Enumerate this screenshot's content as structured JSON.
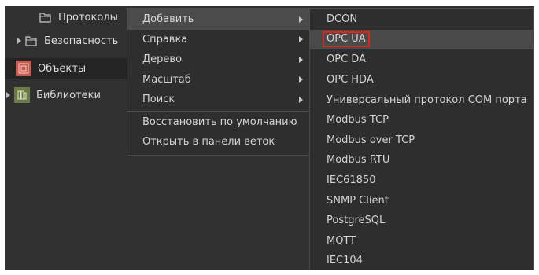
{
  "tree": {
    "items": [
      {
        "label": "Протоколы",
        "icon": "folder-icon"
      },
      {
        "label": "Безопасность",
        "icon": "folder-icon"
      },
      {
        "label": "Объекты",
        "icon": "objects-icon"
      },
      {
        "label": "Библиотеки",
        "icon": "libraries-icon"
      }
    ]
  },
  "context_menu": {
    "items": [
      {
        "label": "Добавить",
        "has_submenu": true
      },
      {
        "label": "Справка",
        "has_submenu": true
      },
      {
        "label": "Дерево",
        "has_submenu": true
      },
      {
        "label": "Масштаб",
        "has_submenu": true
      },
      {
        "label": "Поиск",
        "has_submenu": true
      },
      {
        "label": "Восстановить по умолчанию",
        "has_submenu": false
      },
      {
        "label": "Открыть в панели веток",
        "has_submenu": false
      }
    ]
  },
  "submenu": {
    "items": [
      "DCON",
      "OPC UA",
      "OPC DA",
      "OPC HDA",
      "Универсальный протокол COM порта",
      "Modbus TCP",
      "Modbus over TCP",
      "Modbus RTU",
      "IEC61850",
      "SNMP Client",
      "PostgreSQL",
      "MQTT",
      "IEC104"
    ],
    "highlighted_index": 1
  },
  "colors": {
    "background": "#303030",
    "highlight_border": "#e0241b",
    "objects_icon": "#c95a4f",
    "libraries_icon": "#6c7a45"
  }
}
